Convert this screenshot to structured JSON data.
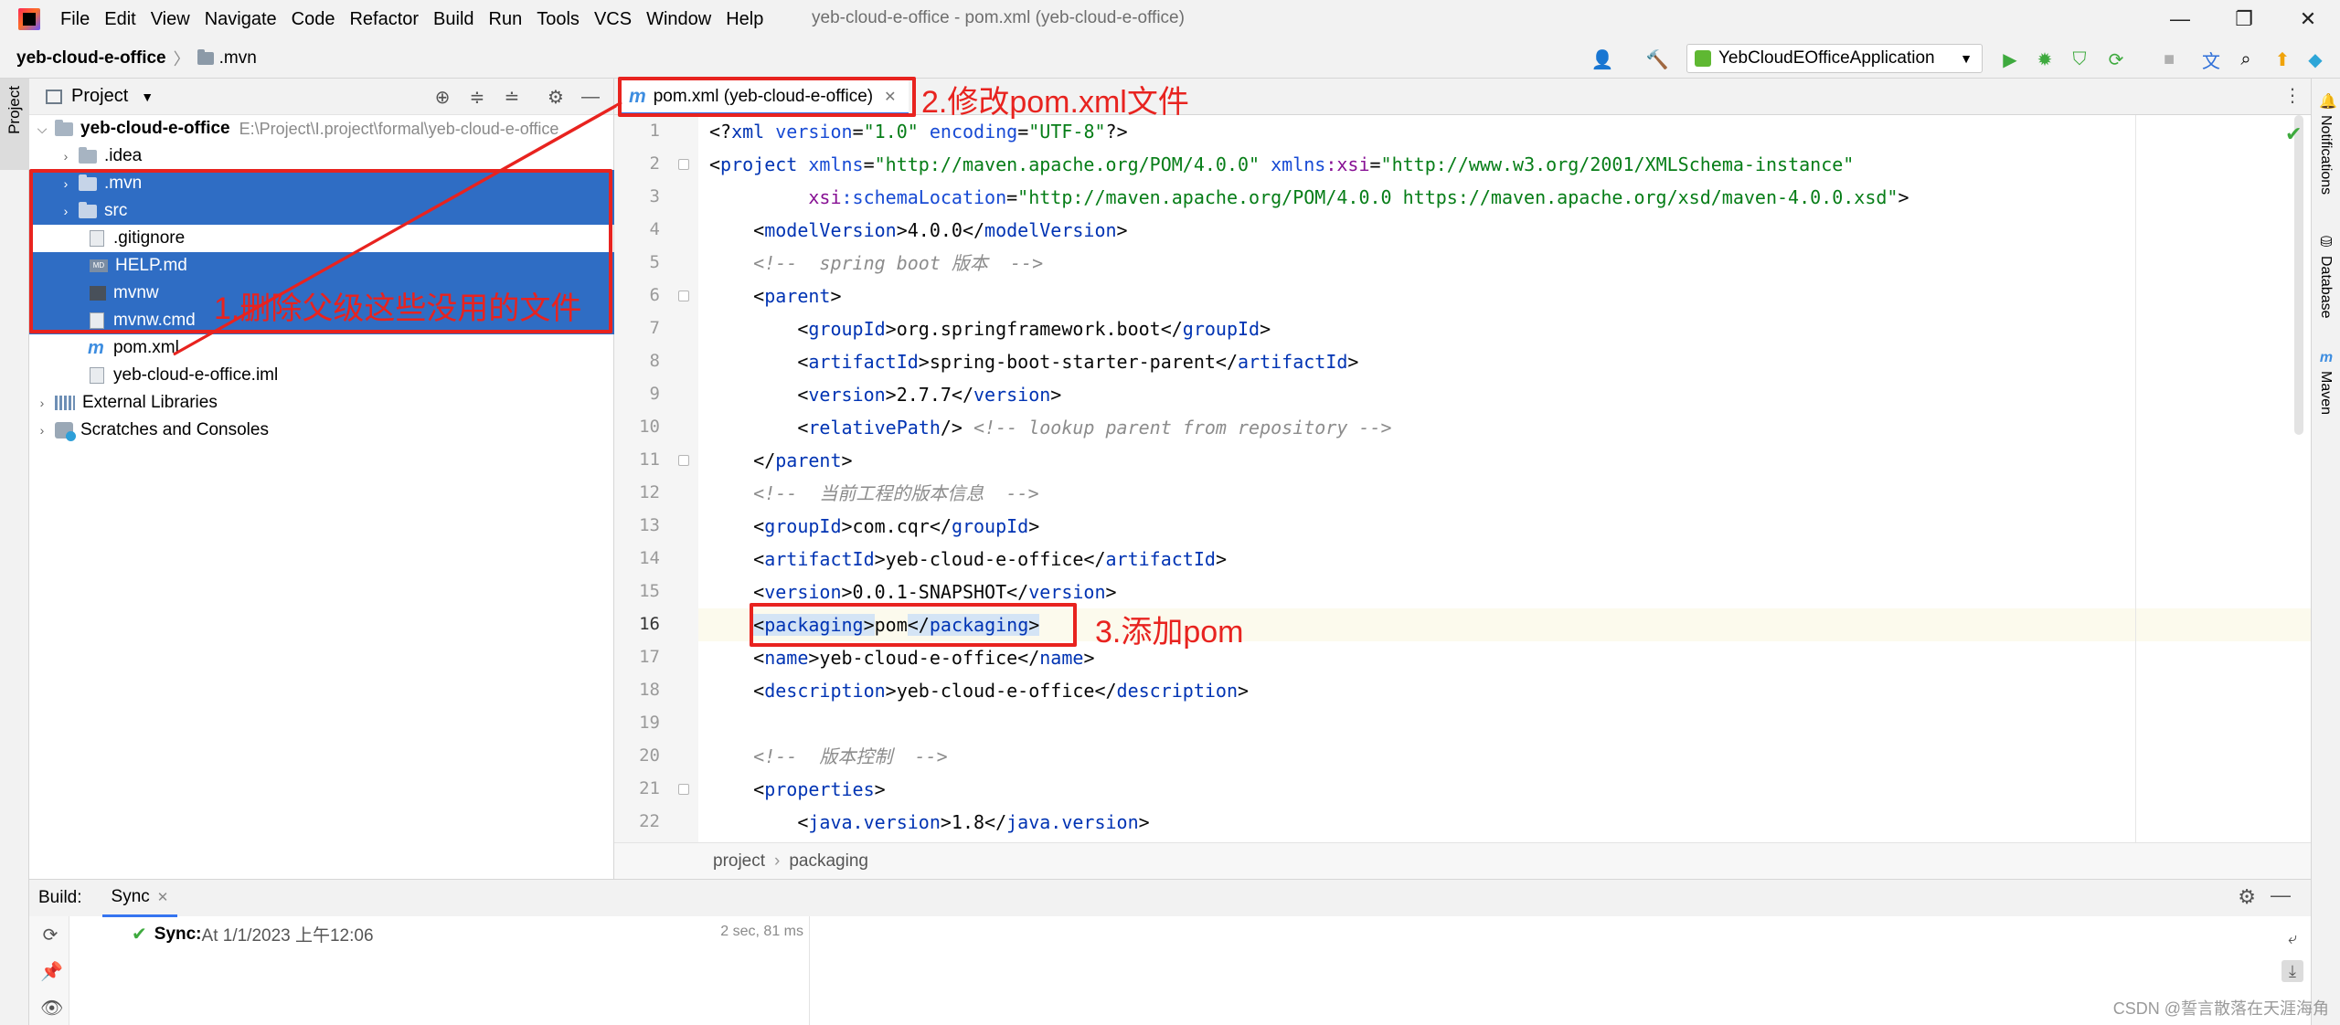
{
  "app": {
    "menu": [
      "File",
      "Edit",
      "View",
      "Navigate",
      "Code",
      "Refactor",
      "Build",
      "Run",
      "Tools",
      "VCS",
      "Window",
      "Help"
    ],
    "window_title": "yeb-cloud-e-office - pom.xml (yeb-cloud-e-office)",
    "window_controls": {
      "minimize": "—",
      "restore": "❐",
      "close": "✕"
    }
  },
  "navbar": {
    "project": "yeb-cloud-e-office",
    "separator": "〉",
    "folder": ".mvn",
    "run_config": "YebCloudEOfficeApplication",
    "icons": [
      "user-icon",
      "hammer-icon",
      "run-icon",
      "debug-icon",
      "coverage-icon",
      "profile-icon",
      "stop-icon",
      "translate-icon",
      "search-icon",
      "update-icon",
      "logo-icon"
    ]
  },
  "left_strip": {
    "label": "Project"
  },
  "project_panel": {
    "title": "Project",
    "root": {
      "name": "yeb-cloud-e-office",
      "path": "E:\\Project\\I.project\\formal\\yeb-cloud-e-office"
    },
    "items": [
      {
        "name": ".idea"
      },
      {
        "name": ".mvn"
      },
      {
        "name": "src"
      },
      {
        "name": ".gitignore"
      },
      {
        "name": "HELP.md"
      },
      {
        "name": "mvnw"
      },
      {
        "name": "mvnw.cmd"
      },
      {
        "name": "pom.xml"
      },
      {
        "name": "yeb-cloud-e-office.iml"
      }
    ],
    "external": "External Libraries",
    "scratches": "Scratches and Consoles"
  },
  "editor": {
    "tab": "pom.xml (yeb-cloud-e-office)",
    "current_line": 16,
    "line_numbers": [
      "1",
      "2",
      "3",
      "4",
      "5",
      "6",
      "7",
      "8",
      "9",
      "10",
      "11",
      "12",
      "13",
      "14",
      "15",
      "16",
      "17",
      "18",
      "19",
      "20",
      "21",
      "22"
    ],
    "code": {
      "l1_a": "<?",
      "l1_b": "xml ",
      "l1_c": "version",
      "l1_d": "=",
      "l1_e": "\"1.0\"",
      "l1_f": " encoding",
      "l1_g": "=",
      "l1_h": "\"UTF-8\"",
      "l1_i": "?>",
      "l2_a": "<",
      "l2_b": "project ",
      "l2_c": "xmlns",
      "l2_d": "=",
      "l2_e": "\"http://maven.apache.org/POM/4.0.0\"",
      "l2_f": " xmlns",
      "l2_g": ":xsi",
      "l2_h": "=",
      "l2_i": "\"http://www.w3.org/2001/XMLSchema-instance\"",
      "l3_a": "         xsi",
      "l3_b": ":schemaLocation",
      "l3_c": "=",
      "l3_d": "\"http://maven.apache.org/POM/4.0.0 https://maven.apache.org/xsd/maven-4.0.0.xsd\"",
      "l3_e": ">",
      "l4_a": "    <",
      "l4_b": "modelVersion",
      "l4_c": ">4.0.0</",
      "l4_d": "modelVersion",
      "l4_e": ">",
      "l5": "    <!--  spring boot 版本  -->",
      "l6_a": "    <",
      "l6_b": "parent",
      "l6_c": ">",
      "l7_a": "        <",
      "l7_b": "groupId",
      "l7_c": ">org.springframework.boot</",
      "l7_d": "groupId",
      "l7_e": ">",
      "l8_a": "        <",
      "l8_b": "artifactId",
      "l8_c": ">spring-boot-starter-parent</",
      "l8_d": "artifactId",
      "l8_e": ">",
      "l9_a": "        <",
      "l9_b": "version",
      "l9_c": ">2.7.7</",
      "l9_d": "version",
      "l9_e": ">",
      "l10_a": "        <",
      "l10_b": "relativePath",
      "l10_c": "/> ",
      "l10_d": "<!-- lookup parent from repository -->",
      "l11_a": "    </",
      "l11_b": "parent",
      "l11_c": ">",
      "l12": "    <!--  当前工程的版本信息  -->",
      "l13_a": "    <",
      "l13_b": "groupId",
      "l13_c": ">com.cqr</",
      "l13_d": "groupId",
      "l13_e": ">",
      "l14_a": "    <",
      "l14_b": "artifactId",
      "l14_c": ">yeb-cloud-e-office</",
      "l14_d": "artifactId",
      "l14_e": ">",
      "l15_a": "    <",
      "l15_b": "version",
      "l15_c": ">0.0.1-SNAPSHOT</",
      "l15_d": "version",
      "l15_e": ">",
      "l16_pre": "    ",
      "l16_a": "<",
      "l16_b": "packaging",
      "l16_c": ">",
      "l16_d": "pom",
      "l16_e": "</",
      "l16_f": "packaging",
      "l16_g": ">",
      "l17_a": "    <",
      "l17_b": "name",
      "l17_c": ">yeb-cloud-e-office</",
      "l17_d": "name",
      "l17_e": ">",
      "l18_a": "    <",
      "l18_b": "description",
      "l18_c": ">yeb-cloud-e-office</",
      "l18_d": "description",
      "l18_e": ">",
      "l20": "    <!--  版本控制  -->",
      "l21_a": "    <",
      "l21_b": "properties",
      "l21_c": ">",
      "l22_a": "        <",
      "l22_b": "java.version",
      "l22_c": ">1.8</",
      "l22_d": "java.version",
      "l22_e": ">"
    },
    "breadcrumb": [
      "project",
      "packaging"
    ]
  },
  "right_strip": {
    "items": [
      "Notifications",
      "Database",
      "Maven"
    ]
  },
  "build": {
    "label": "Build:",
    "tab": "Sync",
    "sync_title": "Sync:",
    "sync_detail": " At 1/1/2023 上午12:06",
    "duration": "2 sec, 81 ms"
  },
  "annotations": {
    "step1": "1.删除父级这些没用的文件",
    "step2": "2.修改pom.xml文件",
    "step3": "3.添加pom",
    "color": "#e8231f"
  },
  "watermark": "CSDN @誓言散落在天涯海角",
  "colors": {
    "selection": "#2f6dc4",
    "tag": "#0033b3",
    "string": "#067d17",
    "comment": "#8c8c8c",
    "namespace": "#871094"
  }
}
